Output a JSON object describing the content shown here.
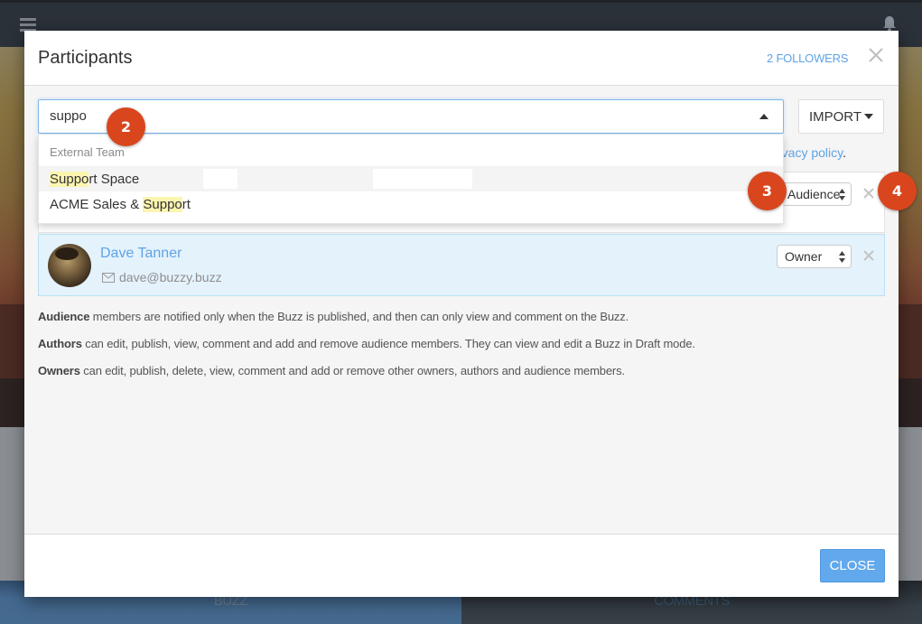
{
  "background_app": {
    "tabs": [
      {
        "label": "BUZZ"
      },
      {
        "label": "COMMENTS"
      }
    ]
  },
  "modal": {
    "title": "Participants",
    "followers_link": "2 FOLLOWERS",
    "search": {
      "value": "suppo",
      "placeholder": ""
    },
    "import_label": "IMPORT",
    "privacy_prefix": "",
    "privacy_link": "vacy policy",
    "privacy_suffix": ".",
    "dropdown": {
      "group_label": "External Team",
      "results": [
        {
          "match": "Suppo",
          "rest": "rt Space",
          "label": "Support Space"
        },
        {
          "before": "ACME Sales & ",
          "match": "Suppo",
          "rest": "rt",
          "label": "ACME Sales & Support"
        }
      ]
    },
    "participants": [
      {
        "name": "",
        "email": "",
        "role": "Audience"
      },
      {
        "name": "Dave Tanner",
        "email": "dave@buzzy.buzz",
        "role": "Owner"
      }
    ],
    "role_info": [
      {
        "role": "Audience",
        "text": " members are notified only when the Buzz is published, and then can only view and comment on the Buzz."
      },
      {
        "role": "Authors",
        "text": " can edit, publish, view, comment and add and remove audience members. They can view and edit a Buzz in Draft mode."
      },
      {
        "role": "Owners",
        "text": " can edit, publish, delete, view, comment and add or remove other owners, authors and audience members."
      }
    ],
    "close_label": "CLOSE"
  },
  "step_badges": [
    "2",
    "3",
    "4"
  ],
  "colors": {
    "accent": "#5fa3e6",
    "primary_button": "#62a8ec",
    "badge": "#d9461e",
    "highlight": "#fbf5b0",
    "owner_row": "#e4f2fc"
  }
}
